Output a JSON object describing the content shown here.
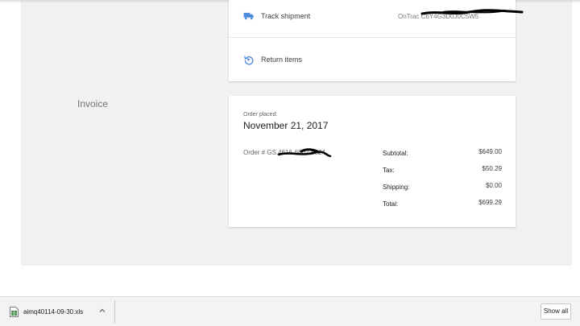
{
  "shipment_card": {
    "track_label": "Track shipment",
    "tracking_value": "OnTrac C6Y4G3D0J0C5W5",
    "return_label": "Return items"
  },
  "invoice": {
    "section_label": "Invoice",
    "order_placed_label": "Order placed:",
    "order_date": "November 21, 2017",
    "order_number": "Order # GS.4616-6802-8824",
    "totals": [
      {
        "label": "Subtotal:",
        "value": "$649.00"
      },
      {
        "label": "Tax:",
        "value": "$50.29"
      },
      {
        "label": "Shipping:",
        "value": "$0.00"
      },
      {
        "label": "Total:",
        "value": "$699.29"
      }
    ]
  },
  "download_bar": {
    "file_name": "aimq40114-09-30.xls",
    "show_all_label": "Show all"
  },
  "colors": {
    "accent_blue": "#4a89dc",
    "page_background": "#f1f1f1"
  },
  "icons": {
    "track": "truck-icon",
    "return": "return-icon",
    "file": "spreadsheet-file-icon",
    "expand": "chevron-up-icon"
  }
}
